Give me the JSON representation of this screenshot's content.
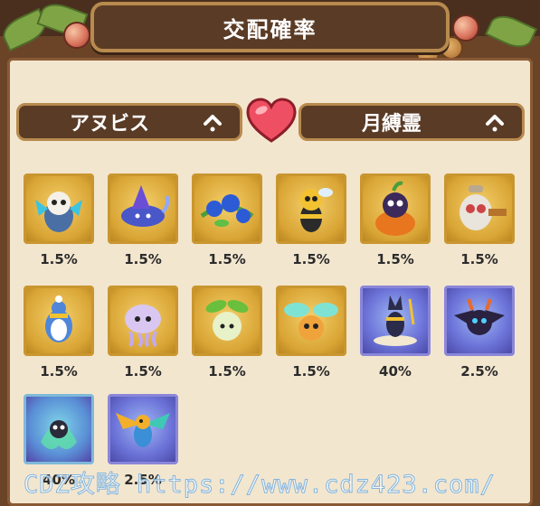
{
  "title": "交配確率",
  "parent_left": {
    "label": "アヌビス"
  },
  "parent_right": {
    "label": "月縛霊"
  },
  "results": [
    {
      "pct": "1.5%",
      "icon": "owl-robot-pet-icon",
      "rarity": "common"
    },
    {
      "pct": "1.5%",
      "icon": "blue-witch-cat-pet-icon",
      "rarity": "common"
    },
    {
      "pct": "1.5%",
      "icon": "blue-flower-vine-pet-icon",
      "rarity": "common"
    },
    {
      "pct": "1.5%",
      "icon": "bee-pet-icon",
      "rarity": "common"
    },
    {
      "pct": "1.5%",
      "icon": "pumpkin-owl-pet-icon",
      "rarity": "common"
    },
    {
      "pct": "1.5%",
      "icon": "cannon-owl-pet-icon",
      "rarity": "common"
    },
    {
      "pct": "1.5%",
      "icon": "penguin-pet-icon",
      "rarity": "common"
    },
    {
      "pct": "1.5%",
      "icon": "jellyfish-pet-icon",
      "rarity": "common"
    },
    {
      "pct": "1.5%",
      "icon": "leaf-sprout-pet-icon",
      "rarity": "common"
    },
    {
      "pct": "1.5%",
      "icon": "firefly-pet-icon",
      "rarity": "common"
    },
    {
      "pct": "40%",
      "icon": "anubis-pet-icon",
      "rarity": "rare"
    },
    {
      "pct": "2.5%",
      "icon": "shadow-dragon-pet-icon",
      "rarity": "rare"
    },
    {
      "pct": "40%",
      "icon": "ghost-spirit-pet-icon",
      "rarity": "rare2"
    },
    {
      "pct": "2.5%",
      "icon": "parrot-pet-icon",
      "rarity": "rare"
    }
  ],
  "watermark": "CDZ攻略 https://www.cdz423.com/",
  "colors": {
    "common_card": "#d9a535",
    "rare_card": "#6c73d8",
    "frame": "#5a3b25",
    "panel": "#f3e6cf"
  }
}
